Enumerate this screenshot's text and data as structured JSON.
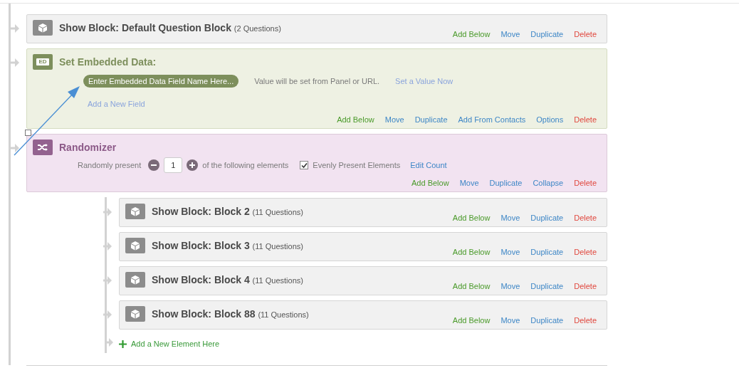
{
  "flow": [
    {
      "kind": "block",
      "title": "Show Block: Default Question Block",
      "count": "(2 Questions)",
      "actions": [
        {
          "label": "Add Below",
          "kind": "add"
        },
        {
          "label": "Move",
          "kind": "link"
        },
        {
          "label": "Duplicate",
          "kind": "link"
        },
        {
          "label": "Delete",
          "kind": "delete"
        }
      ]
    },
    {
      "kind": "embedded_data",
      "icon_label": "ED",
      "title": "Set Embedded Data:",
      "field_name": "Enter Embedded Data Field Name Here...",
      "value_note": "Value will be set from Panel or URL.",
      "set_value_link": "Set a Value Now",
      "add_field_link": "Add a New Field",
      "actions": [
        {
          "label": "Add Below",
          "kind": "add"
        },
        {
          "label": "Move",
          "kind": "link"
        },
        {
          "label": "Duplicate",
          "kind": "link"
        },
        {
          "label": "Add From Contacts",
          "kind": "link"
        },
        {
          "label": "Options",
          "kind": "link"
        },
        {
          "label": "Delete",
          "kind": "delete"
        }
      ]
    },
    {
      "kind": "randomizer",
      "title": "Randomizer",
      "prefix": "Randomly present",
      "count": "1",
      "suffix": "of the following elements",
      "evenly": {
        "label": "Evenly Present Elements",
        "checked": true
      },
      "edit_count": "Edit Count",
      "actions": [
        {
          "label": "Add Below",
          "kind": "add"
        },
        {
          "label": "Move",
          "kind": "link"
        },
        {
          "label": "Duplicate",
          "kind": "link"
        },
        {
          "label": "Collapse",
          "kind": "link"
        },
        {
          "label": "Delete",
          "kind": "delete"
        }
      ],
      "children": [
        {
          "kind": "block",
          "title": "Show Block: Block 2",
          "count": "(11 Questions)",
          "actions": [
            {
              "label": "Add Below",
              "kind": "add"
            },
            {
              "label": "Move",
              "kind": "link"
            },
            {
              "label": "Duplicate",
              "kind": "link"
            },
            {
              "label": "Delete",
              "kind": "delete"
            }
          ]
        },
        {
          "kind": "block",
          "title": "Show Block: Block 3",
          "count": "(11 Questions)",
          "actions": [
            {
              "label": "Add Below",
              "kind": "add"
            },
            {
              "label": "Move",
              "kind": "link"
            },
            {
              "label": "Duplicate",
              "kind": "link"
            },
            {
              "label": "Delete",
              "kind": "delete"
            }
          ]
        },
        {
          "kind": "block",
          "title": "Show Block: Block 4",
          "count": "(11 Questions)",
          "actions": [
            {
              "label": "Add Below",
              "kind": "add"
            },
            {
              "label": "Move",
              "kind": "link"
            },
            {
              "label": "Duplicate",
              "kind": "link"
            },
            {
              "label": "Delete",
              "kind": "delete"
            }
          ]
        },
        {
          "kind": "block",
          "title": "Show Block: Block 88",
          "count": "(11 Questions)",
          "actions": [
            {
              "label": "Add Below",
              "kind": "add"
            },
            {
              "label": "Move",
              "kind": "link"
            },
            {
              "label": "Duplicate",
              "kind": "link"
            },
            {
              "label": "Delete",
              "kind": "delete"
            }
          ]
        }
      ],
      "add_element": "Add a New Element Here"
    }
  ]
}
